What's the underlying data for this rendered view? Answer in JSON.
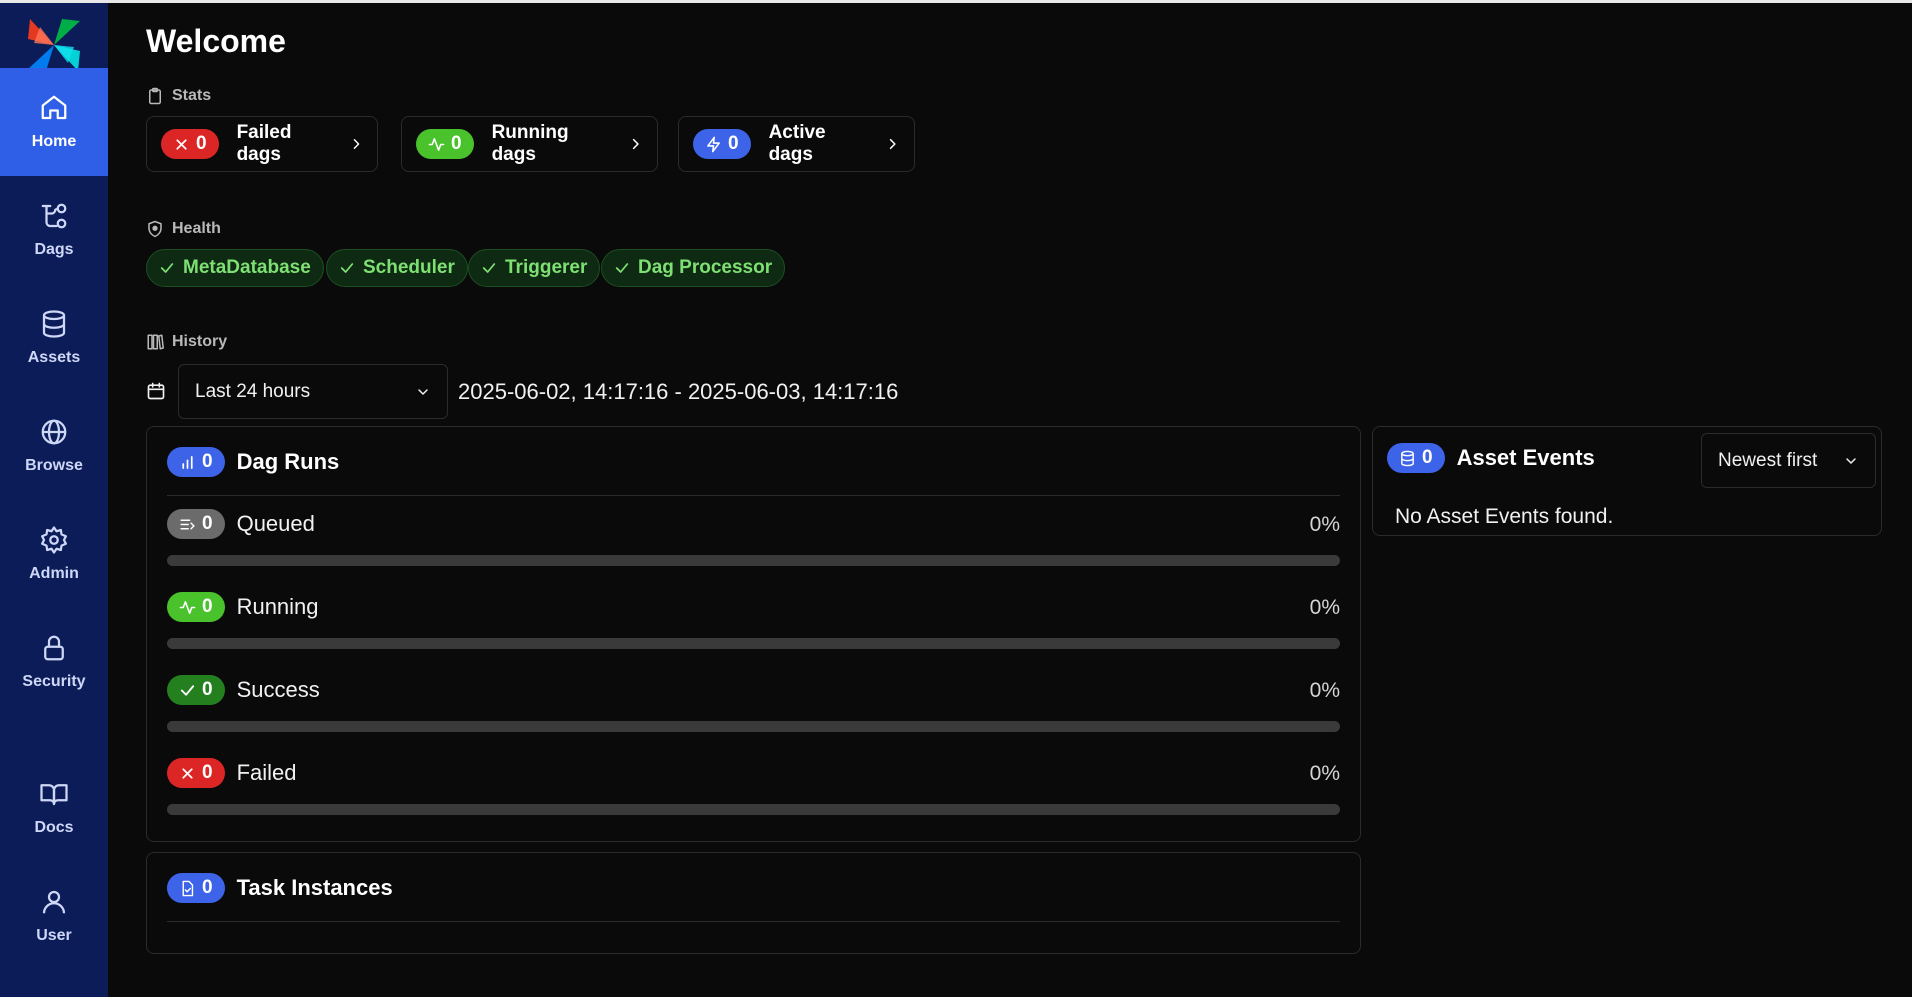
{
  "sidebar": {
    "items": [
      {
        "label": "Home",
        "icon": "home-icon"
      },
      {
        "label": "Dags",
        "icon": "dags-icon"
      },
      {
        "label": "Assets",
        "icon": "database-icon"
      },
      {
        "label": "Browse",
        "icon": "globe-icon"
      },
      {
        "label": "Admin",
        "icon": "gear-icon"
      },
      {
        "label": "Security",
        "icon": "lock-icon"
      },
      {
        "label": "Docs",
        "icon": "book-icon"
      },
      {
        "label": "User",
        "icon": "user-icon"
      }
    ]
  },
  "page": {
    "title": "Welcome"
  },
  "stats": {
    "heading": "Stats",
    "cards": [
      {
        "count": "0",
        "label": "Failed dags",
        "color": "#dc2626"
      },
      {
        "count": "0",
        "label": "Running dags",
        "color": "#4ac22c"
      },
      {
        "count": "0",
        "label": "Active dags",
        "color": "#3d63e8"
      }
    ]
  },
  "health": {
    "heading": "Health",
    "items": [
      "MetaDatabase",
      "Scheduler",
      "Triggerer",
      "Dag Processor"
    ]
  },
  "history": {
    "heading": "History",
    "range_select": "Last 24 hours",
    "date_range": "2025-06-02, 14:17:16 - 2025-06-03, 14:17:16"
  },
  "dag_runs": {
    "title": "Dag Runs",
    "count": "0",
    "rows": [
      {
        "label": "Queued",
        "count": "0",
        "percent": "0%",
        "fraction": 0
      },
      {
        "label": "Running",
        "count": "0",
        "percent": "0%",
        "fraction": 0
      },
      {
        "label": "Success",
        "count": "0",
        "percent": "0%",
        "fraction": 0
      },
      {
        "label": "Failed",
        "count": "0",
        "percent": "0%",
        "fraction": 0
      }
    ]
  },
  "task_instances": {
    "title": "Task Instances",
    "count": "0"
  },
  "asset_events": {
    "title": "Asset Events",
    "count": "0",
    "sort_select": "Newest first",
    "empty_message": "No Asset Events found."
  }
}
